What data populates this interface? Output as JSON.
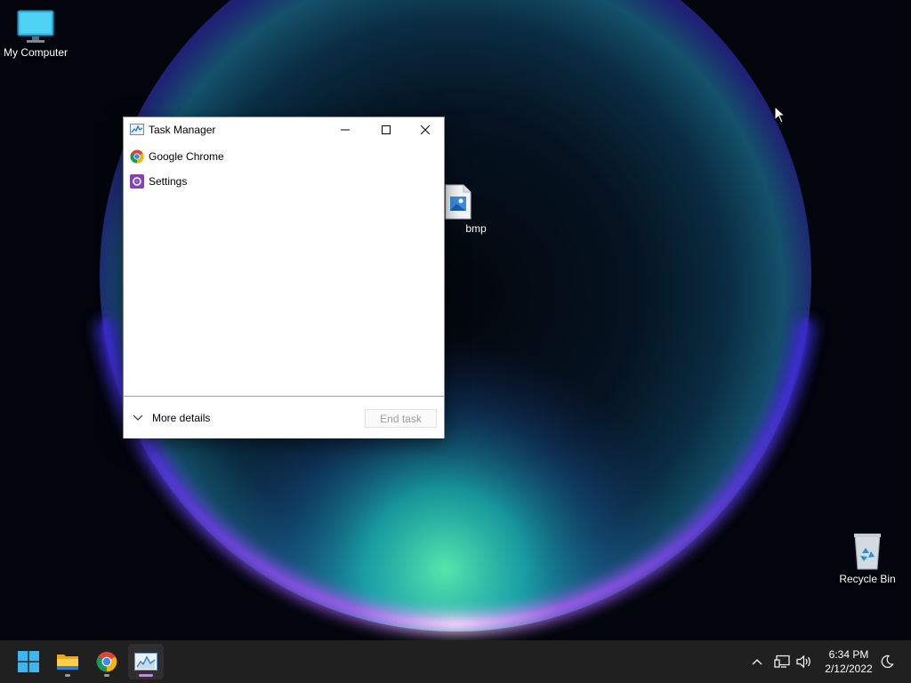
{
  "desktop": {
    "icons": [
      {
        "label": "My Computer",
        "icon": "computer-icon"
      },
      {
        "label": "bmp",
        "icon": "image-file-icon"
      },
      {
        "label": "Recycle Bin",
        "icon": "recycle-bin-icon"
      }
    ]
  },
  "task_manager": {
    "title": "Task Manager",
    "title_icon": "task-manager-icon",
    "processes": [
      {
        "name": "Google Chrome",
        "icon": "chrome-icon"
      },
      {
        "name": "Settings",
        "icon": "settings-icon"
      }
    ],
    "more_details_label": "More details",
    "end_task_label": "End task"
  },
  "taskbar": {
    "apps": [
      {
        "name": "Start",
        "icon": "windows-start-icon"
      },
      {
        "name": "File Explorer",
        "icon": "folder-icon",
        "running": true
      },
      {
        "name": "Google Chrome",
        "icon": "chrome-icon",
        "running": true
      },
      {
        "name": "Task Manager",
        "icon": "task-manager-icon",
        "running": true,
        "active": true
      }
    ],
    "tray": {
      "icons": [
        "chevron-up-icon",
        "network-icon",
        "volume-icon",
        "focus-assist-icon"
      ],
      "time": "6:34 PM",
      "date": "2/12/2022"
    }
  },
  "colors": {
    "taskbar_bg": "#202020",
    "active_indicator": "#ba8fd9",
    "window_bg": "#ffffff"
  }
}
